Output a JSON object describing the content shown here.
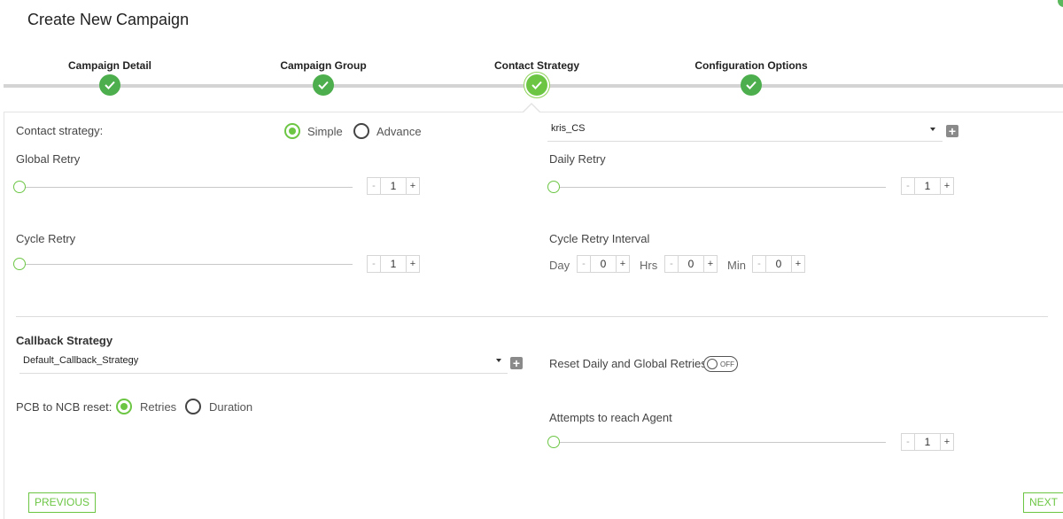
{
  "header": {
    "title": "Create New Campaign"
  },
  "wizard": {
    "steps": [
      {
        "label": "Campaign Detail"
      },
      {
        "label": "Campaign Group"
      },
      {
        "label": "Contact Strategy"
      },
      {
        "label": "Configuration Options"
      }
    ],
    "active_step": "Contact Strategy"
  },
  "contact_strategy": {
    "label": "Contact strategy:",
    "options": [
      "Simple",
      "Advance"
    ],
    "selected": "Simple",
    "dropdown_value": "kris_CS"
  },
  "global_retry": {
    "label": "Global Retry",
    "value": "1",
    "minus": "-",
    "plus": "+"
  },
  "daily_retry": {
    "label": "Daily Retry",
    "value": "1",
    "minus": "-",
    "plus": "+"
  },
  "cycle_retry": {
    "label": "Cycle Retry",
    "value": "1",
    "minus": "-",
    "plus": "+"
  },
  "cycle_retry_interval": {
    "label": "Cycle Retry Interval",
    "day_label": "Day",
    "day_value": "0",
    "hrs_label": "Hrs",
    "hrs_value": "0",
    "min_label": "Min",
    "min_value": "0",
    "minus": "-",
    "plus": "+"
  },
  "callback": {
    "heading": "Callback Strategy",
    "dropdown_value": "Default_Callback_Strategy",
    "reset_label": "Reset Daily and Global Retries",
    "reset_toggle": "OFF",
    "pcb_label": "PCB to NCB reset:",
    "pcb_options": [
      "Retries",
      "Duration"
    ],
    "pcb_selected": "Retries"
  },
  "attempts": {
    "label": "Attempts to reach Agent",
    "value": "1",
    "minus": "-",
    "plus": "+"
  },
  "footer": {
    "previous": "PREVIOUS",
    "next": "NEXT"
  },
  "colors": {
    "accent": "#6cc644",
    "step_complete": "#4cae4c"
  }
}
